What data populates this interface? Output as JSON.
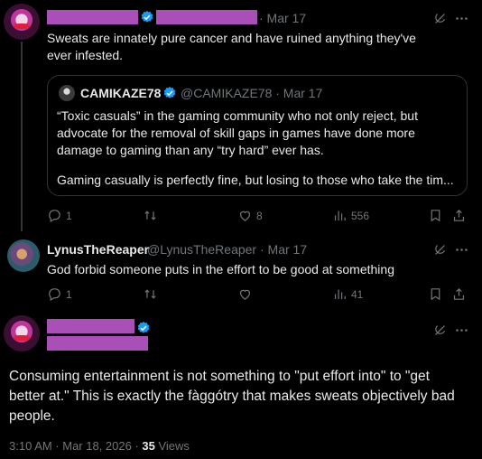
{
  "tweet1": {
    "date": "· Mar 17",
    "text": "Sweats are innately pure cancer and have ruined anything they've ever infested.",
    "quote": {
      "name": "CAMIKAZE78",
      "handle": "@CAMIKAZE78 · Mar 17",
      "para1": "“Toxic casuals” in the gaming community who not only reject, but advocate for the removal of skill gaps in games have done more damage to gaming than any “try hard” ever has.",
      "para2": "Gaming casually is perfectly fine, but losing to those who take the tim..."
    },
    "actions": {
      "replies": "1",
      "likes": "8",
      "views": "556"
    }
  },
  "tweet2": {
    "name": "LynusTheReaper",
    "handle": "@LynusTheReaper · Mar 17",
    "text": "God forbid someone puts in the effort to be good at something",
    "actions": {
      "replies": "1",
      "views": "41"
    }
  },
  "tweet3": {
    "text": "Consuming entertainment is not something to \"put effort into\" to \"get better at.\" This is exactly the fàggótry that makes sweats objectively bad people.",
    "timestamp": "3:10 AM · Mar 18, 2026 · ",
    "views_count": "35",
    "views_label": " Views"
  },
  "icons": [
    "grok-icon",
    "more-icon",
    "reply-icon",
    "retweet-icon",
    "like-icon",
    "views-icon",
    "bookmark-icon",
    "share-icon",
    "verified-badge-icon"
  ],
  "colors": {
    "background": "#000000",
    "text": "#e7e9ea",
    "muted": "#71767b",
    "verified": "#1d9bf0",
    "divider": "#2f3336",
    "redaction": "#a94fb8"
  }
}
